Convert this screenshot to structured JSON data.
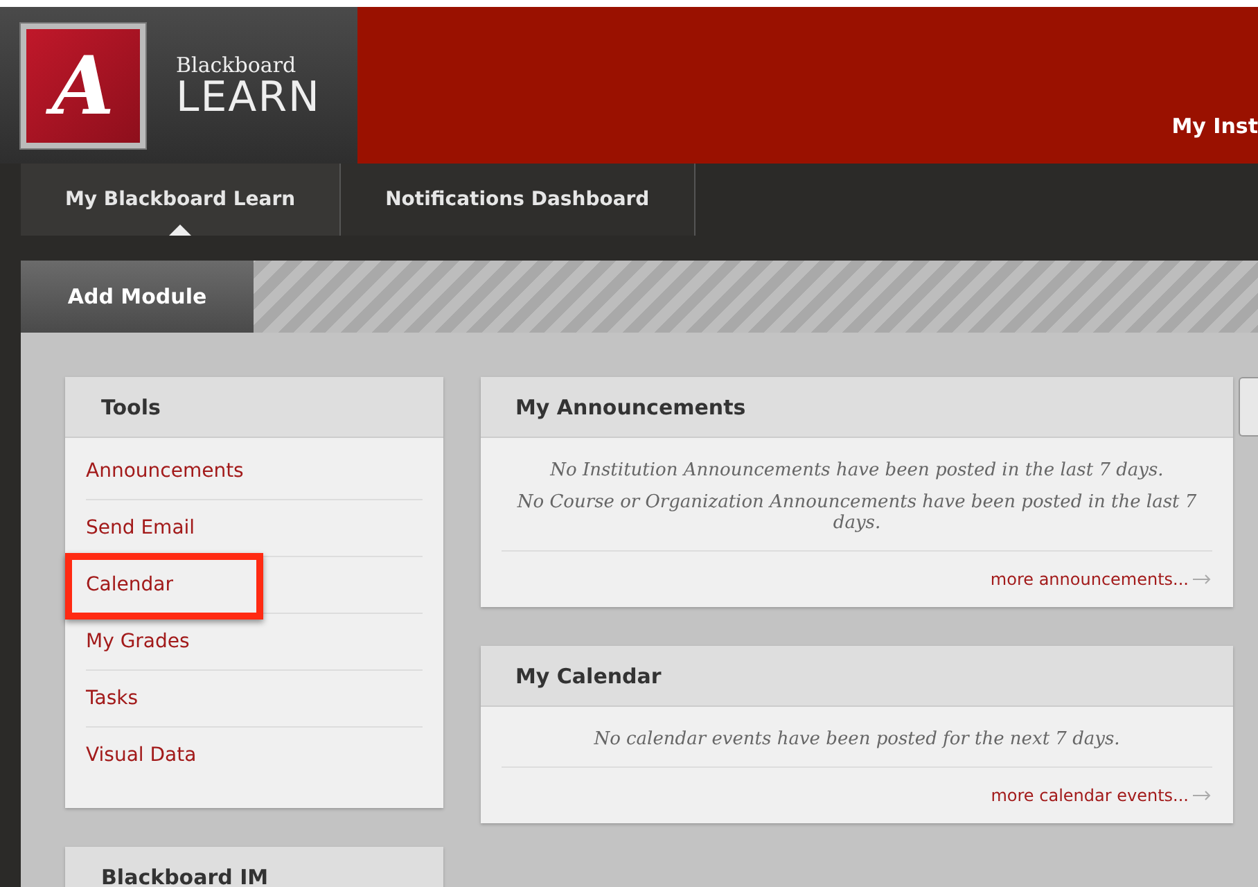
{
  "header": {
    "logo_letter": "A",
    "brand_top": "Blackboard",
    "brand_bottom": "LEARN",
    "institution_tab": "My Inst"
  },
  "tabs": [
    {
      "label": "My Blackboard Learn",
      "selected": true
    },
    {
      "label": "Notifications Dashboard",
      "selected": false
    }
  ],
  "add_module": "Add Module",
  "tools": {
    "title": "Tools",
    "items": [
      {
        "label": "Announcements",
        "highlighted": false
      },
      {
        "label": "Send Email",
        "highlighted": false
      },
      {
        "label": "Calendar",
        "highlighted": true
      },
      {
        "label": "My Grades",
        "highlighted": false
      },
      {
        "label": "Tasks",
        "highlighted": false
      },
      {
        "label": "Visual Data",
        "highlighted": false
      }
    ]
  },
  "im_module": {
    "title": "Blackboard IM"
  },
  "modules": [
    {
      "title": "My Announcements",
      "messages": [
        "No Institution Announcements have been posted in the last 7 days.",
        "No Course or Organization Announcements have been posted in the last 7 days."
      ],
      "more": "more announcements..."
    },
    {
      "title": "My Calendar",
      "messages": [
        "No calendar events have been posted for the next 7 days."
      ],
      "more": "more calendar events..."
    }
  ]
}
